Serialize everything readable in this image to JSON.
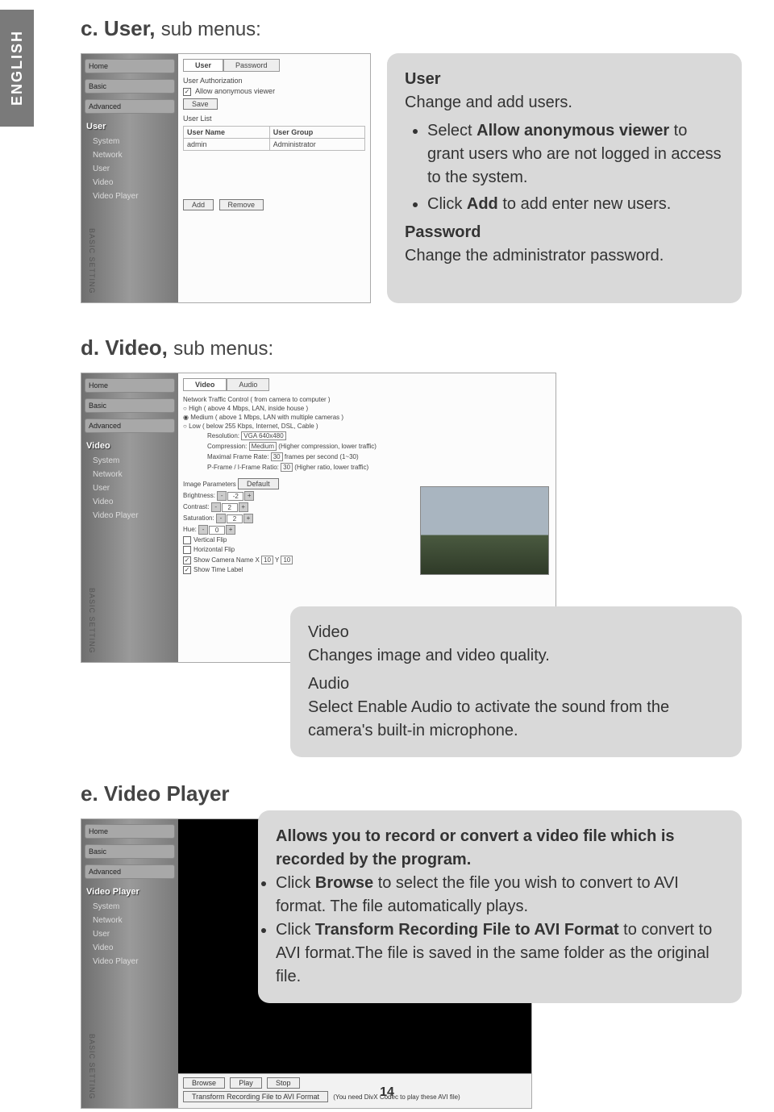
{
  "language_tab": "ENGLISH",
  "page_number": "14",
  "sections": {
    "c": {
      "letter": "c.",
      "title": "User,",
      "sub": "sub menus:"
    },
    "d": {
      "letter": "d.",
      "title": "Video,",
      "sub": "sub menus:"
    },
    "e": {
      "letter": "e.",
      "title": "Video Player",
      "sub": ""
    }
  },
  "sidebar_common": {
    "nav_home": "Home",
    "nav_basic": "Basic",
    "nav_adv": "Advanced",
    "items": [
      "System",
      "Network",
      "User",
      "Video",
      "Video Player"
    ],
    "basic_setting": "BASIC SETTING"
  },
  "user_screenshot": {
    "menu_title": "User",
    "tabs": [
      "User",
      "Password"
    ],
    "auth_header": "User Authorization",
    "checkbox": "Allow anonymous viewer",
    "save_btn": "Save",
    "list_header": "User List",
    "col1": "User Name",
    "col2": "User Group",
    "row1_c1": "admin",
    "row1_c2": "Administrator",
    "add_btn": "Add",
    "remove_btn": "Remove"
  },
  "callout_c": {
    "h1": "User",
    "p1": "Change and add users.",
    "li1a": "Select ",
    "li1b": "Allow anonymous viewer",
    "li1c": " to grant users who are not logged in access to the system.",
    "li2a": "Click ",
    "li2b": "Add",
    "li2c": " to add enter new users.",
    "h2": "Password",
    "p2": "Change the administrator password."
  },
  "video_screenshot": {
    "menu_title": "Video",
    "tabs": [
      "Video",
      "Audio"
    ],
    "traffic_header": "Network Traffic Control ( from camera to computer )",
    "opt_high": "High    ( above 4 Mbps, LAN, inside house )",
    "opt_med": "Medium ( above 1 Mbps, LAN with multiple cameras )",
    "opt_low": "Low    ( below 255 Kbps, Internet, DSL, Cable )",
    "res_label": "Resolution:",
    "res_val": "VGA 640x480",
    "comp_label": "Compression:",
    "comp_val": "Medium",
    "comp_hint": "(Higher compression, lower traffic)",
    "fr_label": "Maximal Frame Rate:",
    "fr_val": "30",
    "fr_hint": "frames per second (1~30)",
    "pi_label": "P-Frame / I-Frame Ratio:",
    "pi_val": "30",
    "pi_hint": "(Higher ratio, lower traffic)",
    "img_params": "Image Parameters",
    "default_btn": "Default",
    "brightness": "Brightness:",
    "contrast": "Contrast:",
    "saturation": "Saturation:",
    "hue": "Hue:",
    "bval": "-2",
    "cval": "2",
    "sval": "2",
    "hval": "0",
    "vflip": "Vertical Flip",
    "hflip": "Horizontal Flip",
    "showname": "Show Camera Name X",
    "xval": "10",
    "ylabel": "Y",
    "yval": "10",
    "showtime": "Show Time Label"
  },
  "callout_d": {
    "h1": "Video",
    "p1": "Changes image and video quality.",
    "h2": "Audio",
    "p2": "Select Enable Audio to activate the sound from the camera's built-in microphone."
  },
  "player_screenshot": {
    "menu_title": "Video Player",
    "browse_btn": "Browse",
    "play_btn": "Play",
    "stop_btn": "Stop",
    "transform_btn": "Transform Recording File to AVI Format",
    "note": "(You need DivX Codec to play these AVI file)"
  },
  "callout_e": {
    "p1": "Allows you to record or convert a video file which is recorded by the program.",
    "li1a": "Click ",
    "li1b": "Browse",
    "li1c": " to select the file you wish to convert to AVI format. The file automatically plays.",
    "li2a": "Click ",
    "li2b": "Transform Recording File to AVI Format",
    "li2c": " to convert to AVI format.The file is saved in the same folder as the original file."
  }
}
